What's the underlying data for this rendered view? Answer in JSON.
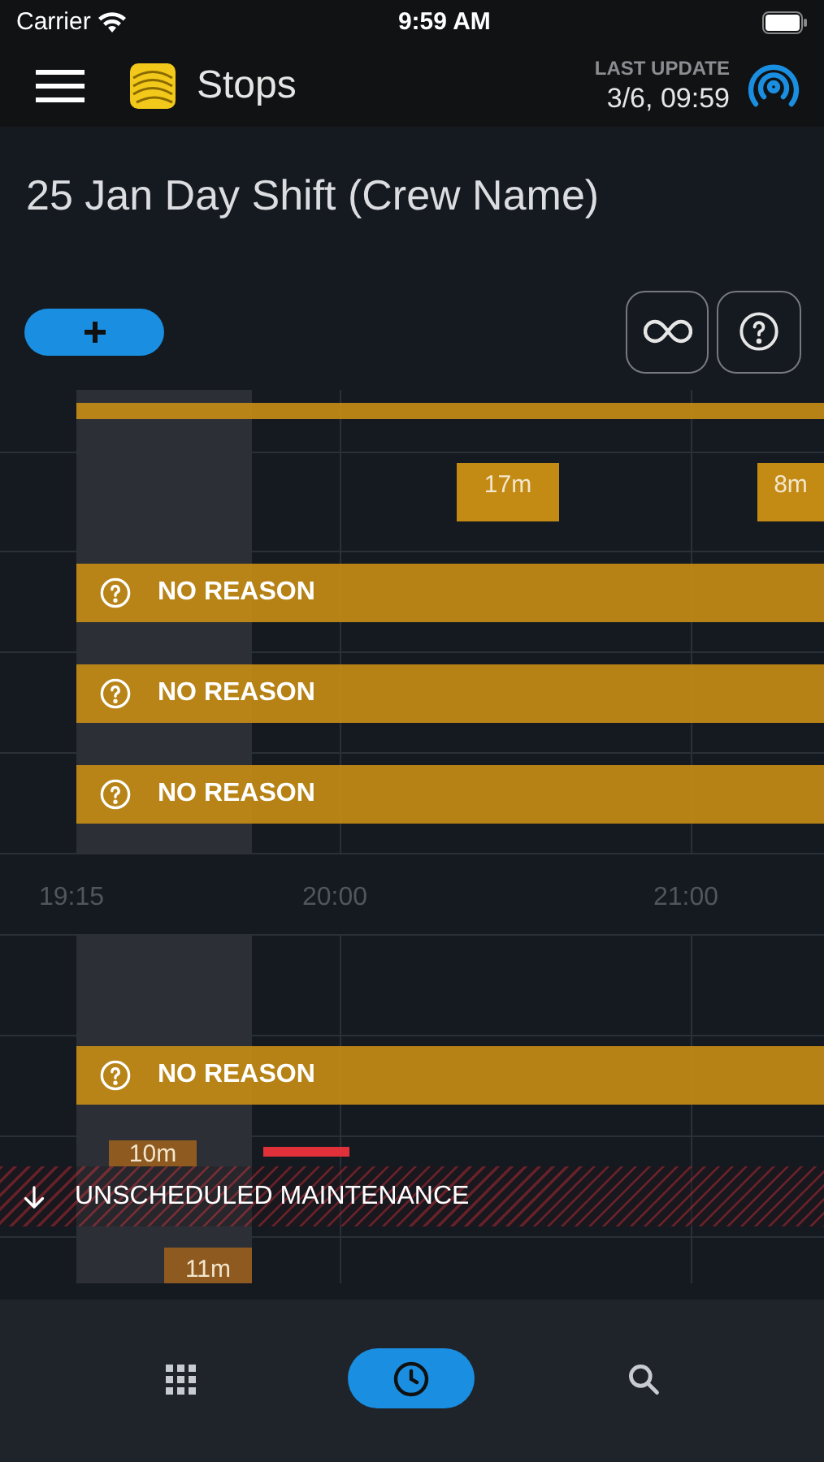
{
  "status_bar": {
    "carrier": "Carrier",
    "time": "9:59 AM"
  },
  "header": {
    "title": "Stops",
    "last_update_label": "LAST UPDATE",
    "last_update_value": "3/6, 09:59"
  },
  "shift_title": "25 Jan Day Shift (Crew Name)",
  "timeline": {
    "upper_rows": [
      {
        "items": [
          {
            "kind": "bar"
          }
        ]
      },
      {
        "items": [
          {
            "kind": "duration",
            "label": "17m",
            "color": "#c38b14"
          },
          {
            "kind": "duration",
            "label": "8m",
            "color": "#c38b14"
          }
        ]
      },
      {
        "items": [
          {
            "kind": "reason",
            "label": "NO REASON"
          }
        ]
      },
      {
        "items": [
          {
            "kind": "reason",
            "label": "NO REASON"
          }
        ]
      },
      {
        "items": [
          {
            "kind": "reason",
            "label": "NO REASON"
          }
        ]
      }
    ],
    "axis_labels": [
      "19:15",
      "20:00",
      "21:00"
    ],
    "lower_rows": [
      {
        "items": [
          {
            "kind": "reason",
            "label": "NO REASON"
          }
        ]
      },
      {
        "items": [
          {
            "kind": "duration",
            "label": "10m",
            "color": "#8e5a1f"
          },
          {
            "kind": "marker"
          },
          {
            "kind": "band",
            "label": "UNSCHEDULED MAINTENANCE"
          }
        ]
      },
      {
        "items": [
          {
            "kind": "duration",
            "label": "11m",
            "color": "#8e5a1f"
          }
        ]
      }
    ]
  },
  "nav": [
    {
      "kind": "apps",
      "selected": false
    },
    {
      "kind": "history",
      "selected": true
    },
    {
      "kind": "search",
      "selected": false
    }
  ]
}
